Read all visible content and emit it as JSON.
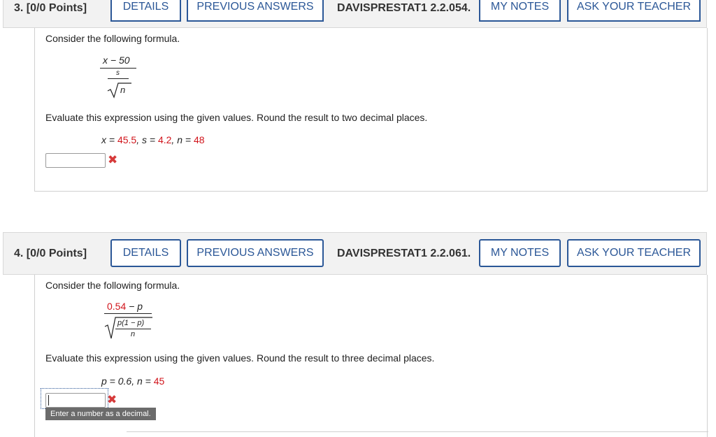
{
  "q3": {
    "number": "3.",
    "points": "[0/0 Points]",
    "buttons": {
      "details": "DETAILS",
      "previous": "PREVIOUS ANSWERS",
      "notes": "MY NOTES",
      "ask": "ASK YOUR TEACHER"
    },
    "reference": "DAVISPRESTAT1 2.2.054.",
    "intro": "Consider the following formula.",
    "formula": {
      "numerator": "x − 50",
      "inner_num": "s",
      "inner_den": "n"
    },
    "instruction": "Evaluate this expression using the given values. Round the result to two decimal places.",
    "values": {
      "x_label": "x = ",
      "x": "45.5",
      "s_label": ", s = ",
      "s": "4.2",
      "n_label": ", n = ",
      "n": "48"
    },
    "answer_value": "",
    "incorrect_icon": "x-mark-icon"
  },
  "q4": {
    "number": "4.",
    "points": "[0/0 Points]",
    "buttons": {
      "details": "DETAILS",
      "previous": "PREVIOUS ANSWERS",
      "notes": "MY NOTES",
      "ask": "ASK YOUR TEACHER"
    },
    "reference": "DAVISPRESTAT1 2.2.061.",
    "intro": "Consider the following formula.",
    "formula": {
      "num_value": "0.54",
      "num_rest": " − p",
      "inner_num": "p(1 − p)",
      "inner_den": "n"
    },
    "instruction": "Evaluate this expression using the given values. Round the result to three decimal places.",
    "values": {
      "p_label": "p = 0.6, n = ",
      "n": "45"
    },
    "answer_value": "",
    "tooltip": "Enter a number as a decimal.",
    "incorrect_icon": "x-mark-icon"
  },
  "colors": {
    "accent": "#2b5797",
    "error": "#d1141b",
    "header_bg": "#f2f2f2"
  }
}
